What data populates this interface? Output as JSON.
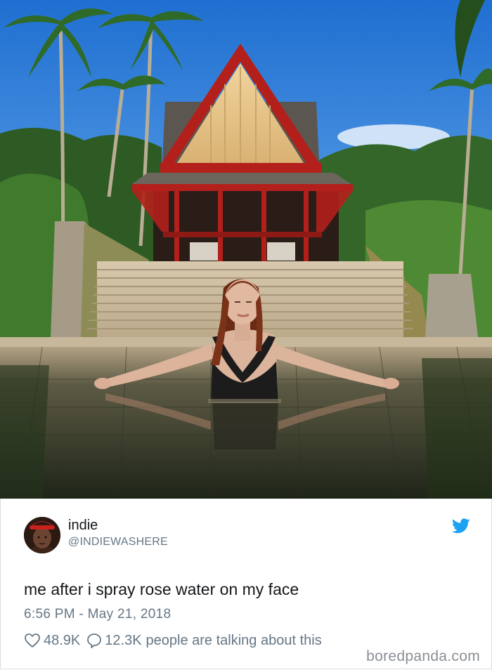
{
  "photo": {
    "subject": "woman-in-infinity-pool",
    "background": "thai-pavilion-with-palms"
  },
  "tweet": {
    "display_name": "indie",
    "handle": "@INDIEWASHERE",
    "text": "me after i spray rose water on my face",
    "timestamp": "6:56 PM - May 21, 2018",
    "likes": "48.9K",
    "replies": "12.3K",
    "talking_label": "people are talking about this",
    "platform_icon": "twitter-bird-icon",
    "accent_color": "#1da1f2"
  },
  "watermark": "boredpanda.com"
}
